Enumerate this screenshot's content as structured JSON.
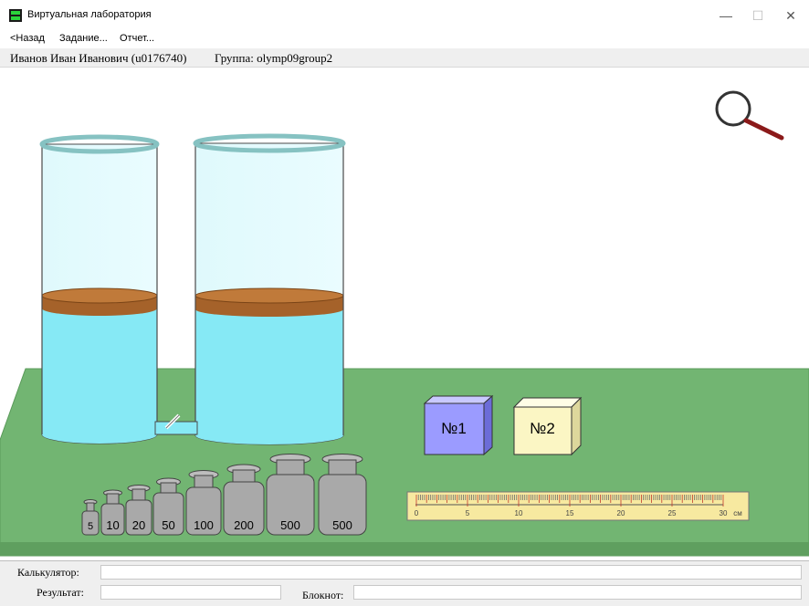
{
  "window": {
    "title": "Виртуальная лаборатория",
    "controls": [
      "—",
      "☐",
      "✕"
    ]
  },
  "menu": {
    "back": "<Назад",
    "task": "Задание...",
    "report": "Отчет..."
  },
  "user": {
    "name": "Иванов Иван Иванович (u0176740)",
    "group": "Группа: olymp09group2"
  },
  "scene": {
    "blocks": [
      "№1",
      "№2"
    ],
    "block_colors": [
      "#9b9bff",
      "#fbf6c4"
    ],
    "weights": [
      "5",
      "10",
      "20",
      "50",
      "100",
      "200",
      "500",
      "500"
    ],
    "ruler_labels": [
      "0",
      "5",
      "10",
      "15",
      "20",
      "25",
      "30",
      "см"
    ],
    "water_color": "#86e9f5",
    "table_color": "#72b572",
    "magnifier_icon": "magnifier-icon"
  },
  "bottom": {
    "calculator_label": "Калькулятор:",
    "result_label": "Результат:",
    "notepad_label": "Блокнот:"
  }
}
